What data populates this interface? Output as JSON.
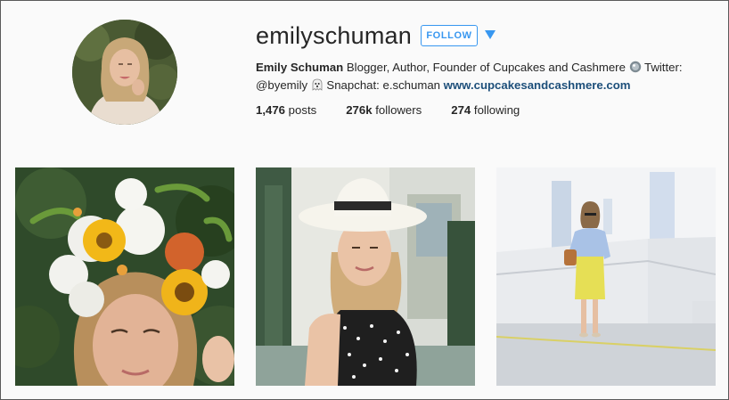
{
  "profile": {
    "username": "emilyschuman",
    "follow_label": "FOLLOW",
    "dropdown_icon": "caret-down-icon",
    "bio": {
      "name": "Emily Schuman",
      "text1": " Blogger, Author, Founder of Cupcakes and Cashmere ",
      "text2": " Twitter:",
      "handle": "@byemily",
      "text3": " Snapchat: e.schuman ",
      "website": "www.cupcakesandcashmere.com"
    },
    "stats": {
      "posts_count": "1,476",
      "posts_label": " posts",
      "followers_count": "276k",
      "followers_label": " followers",
      "following_count": "274",
      "following_label": " following"
    }
  },
  "posts": [
    {
      "description": "flower-crown-portrait"
    },
    {
      "description": "panama-hat-polka-dot-dress"
    },
    {
      "description": "yellow-skirt-street-style"
    }
  ],
  "colors": {
    "accent": "#3897f0",
    "link": "#1d4f7a",
    "text": "#262626"
  }
}
